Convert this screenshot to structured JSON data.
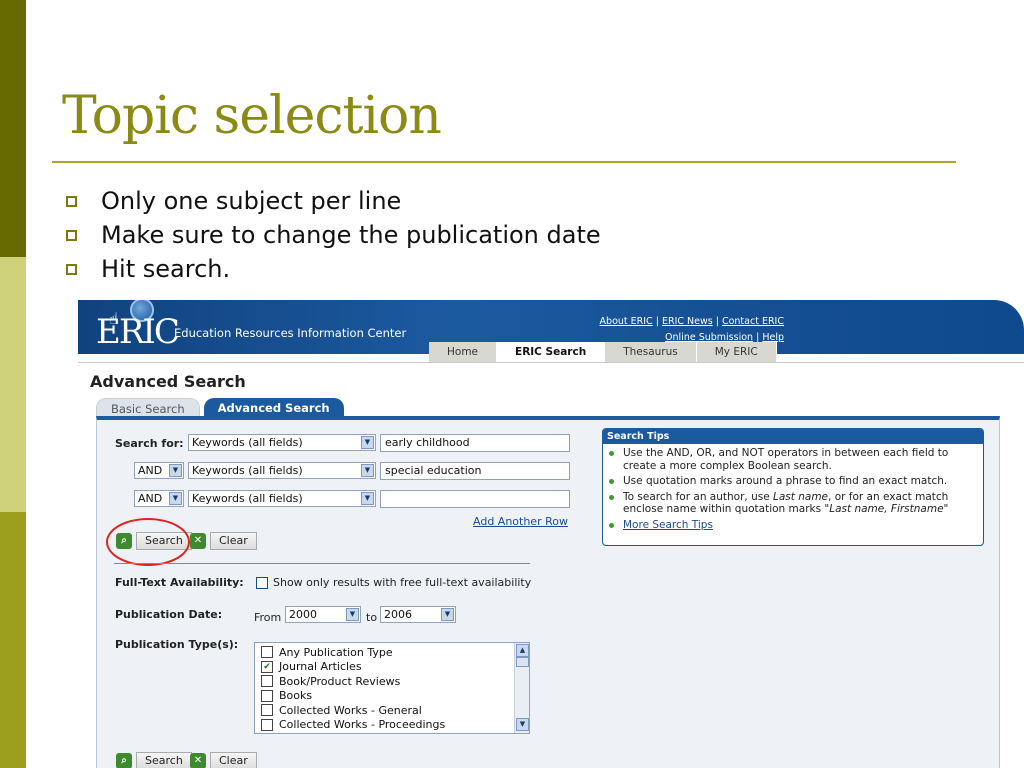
{
  "slide": {
    "title": "Topic selection",
    "bullets": [
      "Only one subject per line",
      "Make sure to change the publication date",
      "Hit search."
    ]
  },
  "eric": {
    "logo_text": "ERIC",
    "logo_subtitle": "Education Resources Information Center",
    "top_links": {
      "about": "About ERIC",
      "news": "ERIC News",
      "contact": "Contact ERIC",
      "submission": "Online Submission",
      "help": "Help",
      "sep": "|"
    },
    "nav_tabs": [
      "Home",
      "ERIC Search",
      "Thesaurus",
      "My ERIC"
    ],
    "active_nav_tab": "ERIC Search",
    "page_heading": "Advanced Search",
    "search_tabs": [
      "Basic Search",
      "Advanced Search"
    ],
    "active_search_tab": "Advanced Search",
    "search_for_label": "Search for:",
    "rows": [
      {
        "operator": "",
        "field": "Keywords (all fields)",
        "value": "early childhood"
      },
      {
        "operator": "AND",
        "field": "Keywords (all fields)",
        "value": "special education"
      },
      {
        "operator": "AND",
        "field": "Keywords (all fields)",
        "value": ""
      }
    ],
    "add_row_link": "Add Another Row",
    "search_button": "Search",
    "clear_button": "Clear",
    "fulltext_label": "Full-Text Availability:",
    "fulltext_option": "Show only results with free full-text availability",
    "pubdate_label": "Publication Date:",
    "from_label": "From",
    "to_label": "to",
    "from_year": "2000",
    "to_year": "2006",
    "pubtype_label": "Publication Type(s):",
    "pub_types": [
      {
        "label": "Any Publication Type",
        "checked": false
      },
      {
        "label": "Journal Articles",
        "checked": true
      },
      {
        "label": "Book/Product Reviews",
        "checked": false
      },
      {
        "label": "Books",
        "checked": false
      },
      {
        "label": "Collected Works - General",
        "checked": false
      },
      {
        "label": "Collected Works - Proceedings",
        "checked": false
      }
    ],
    "tips": {
      "heading": "Search Tips",
      "items": [
        "Use the AND, OR, and NOT operators in between each field to create a more complex Boolean search.",
        "Use quotation marks around a phrase to find an exact match."
      ],
      "author_tip": {
        "a": "To search for an author, use ",
        "last": "Last name",
        "b": ", or for an exact match enclose name within quotation marks ",
        "quoted": "\"Last name, Firstname\""
      },
      "more_link": "More Search Tips"
    }
  },
  "colors": {
    "title": "#8a8a14",
    "eric_blue": "#1c5aa0",
    "highlight_oval": "#e0211e"
  }
}
